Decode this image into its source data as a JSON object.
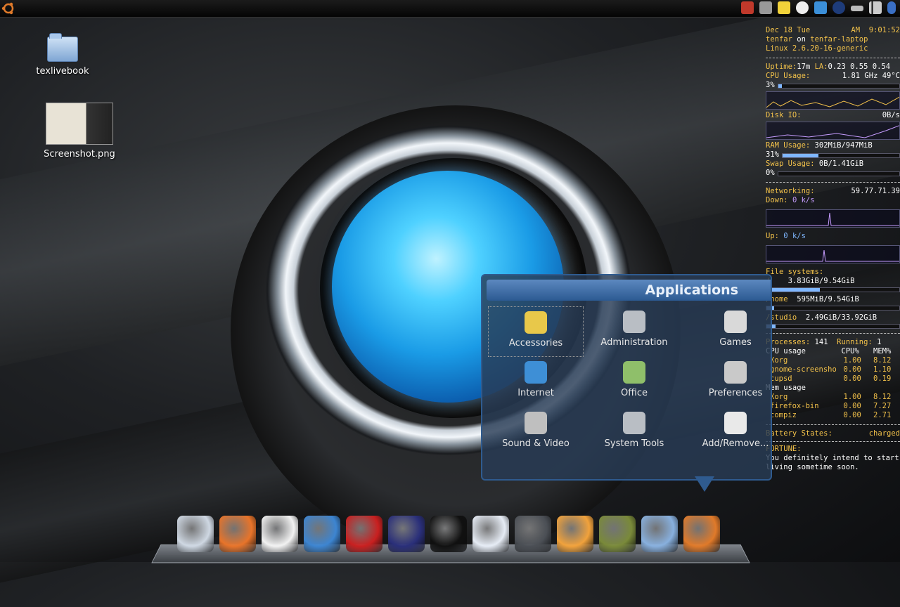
{
  "top_panel": {
    "menu_icon": "ubuntu-logo-icon",
    "tray_icons": [
      "logout-icon",
      "volume-icon",
      "notes-icon",
      "gnome-foot-icon",
      "network-manager-icon",
      "globe-icon",
      "drive-icon",
      "signal-icon",
      "bluetooth-icon"
    ]
  },
  "desktop": {
    "icons": [
      {
        "label": "texlivebook",
        "icon": "folder-icon"
      },
      {
        "label": "Screenshot.png",
        "icon": "image-thumbnail-icon"
      }
    ]
  },
  "conky": {
    "date": "Dec  18  Tue",
    "ampm": "AM",
    "time": "9:01:52",
    "user": "tenfar",
    "on": "on",
    "host": "tenfar-laptop",
    "kernel": "Linux 2.6.20-16-generic",
    "uptime_label": "Uptime:",
    "uptime": "17m",
    "la_label": "LA:",
    "la": "0.23 0.55 0.54",
    "cpu_label": "CPU Usage:",
    "cpu_freq": "1.81 GHz 49°C",
    "cpu_pct": "3%",
    "cpu_fraction": 0.03,
    "disk_label": "Disk IO:",
    "disk_val": "0B/s",
    "ram_label": "RAM Usage:",
    "ram_val": "302MiB/947MiB",
    "ram_pct": "31%",
    "ram_fraction": 0.31,
    "swap_label": "Swap Usage:",
    "swap_val": "0B/1.41GiB",
    "swap_pct": "0%",
    "swap_fraction": 0.0,
    "net_label": "Networking:",
    "net_ip": "59.77.71.39",
    "down_label": "Down:",
    "down_val": "0 k/s",
    "up_label": "Up:",
    "up_val": "0 k/s",
    "fs_label": "File systems:",
    "fs": [
      {
        "mount": "/",
        "val": "3.83GiB/9.54GiB",
        "fraction": 0.4
      },
      {
        "mount": "/home",
        "val": "595MiB/9.54GiB",
        "fraction": 0.06
      },
      {
        "mount": "/studio",
        "val": "2.49GiB/33.92GiB",
        "fraction": 0.07
      }
    ],
    "proc_label": "Processes:",
    "proc_count": "141",
    "running_label": "Running:",
    "running_count": "1",
    "cpu_usage_title": "CPU usage",
    "cpu_col": "CPU%",
    "mem_col": "MEM%",
    "cpu_procs": [
      {
        "name": "Xorg",
        "cpu": "1.00",
        "mem": "8.12"
      },
      {
        "name": "gnome-screensho",
        "cpu": "0.00",
        "mem": "1.10"
      },
      {
        "name": "cupsd",
        "cpu": "0.00",
        "mem": "0.19"
      }
    ],
    "mem_usage_title": "Mem usage",
    "mem_procs": [
      {
        "name": "Xorg",
        "cpu": "1.00",
        "mem": "8.12"
      },
      {
        "name": "firefox-bin",
        "cpu": "0.00",
        "mem": "7.27"
      },
      {
        "name": "compiz",
        "cpu": "0.00",
        "mem": "2.71"
      }
    ],
    "battery_label": "Battery States:",
    "battery_val": "charged",
    "fortune_label": "FORTUNE:",
    "fortune_text": "You definitely intend to start living sometime soon."
  },
  "apps_menu": {
    "title": "Applications",
    "items": [
      {
        "label": "Accessories",
        "icon": "accessories-icon",
        "color": "#e8c84a"
      },
      {
        "label": "Administration",
        "icon": "gear-icon",
        "color": "#b9bec4"
      },
      {
        "label": "Games",
        "icon": "joystick-icon",
        "color": "#d9d9d9"
      },
      {
        "label": "Internet",
        "icon": "globe-icon",
        "color": "#3e8fd6"
      },
      {
        "label": "Office",
        "icon": "office-icon",
        "color": "#8fbf6a"
      },
      {
        "label": "Preferences",
        "icon": "preferences-icon",
        "color": "#c9c9c9"
      },
      {
        "label": "Sound & Video",
        "icon": "film-reel-icon",
        "color": "#bfbfbf"
      },
      {
        "label": "System Tools",
        "icon": "gear-icon",
        "color": "#b9bec4"
      },
      {
        "label": "Add/Remove...",
        "icon": "package-cd-icon",
        "color": "#e9e9e9"
      }
    ]
  },
  "dock": {
    "items": [
      {
        "icon": "computer-icon",
        "color": "#cfd8e3"
      },
      {
        "icon": "firefox-icon",
        "color": "#e8742a"
      },
      {
        "icon": "pidgin-icon",
        "color": "#f2f2f2"
      },
      {
        "icon": "fish-icon",
        "color": "#3d85d1"
      },
      {
        "icon": "dictionary-icon",
        "color": "#c92020"
      },
      {
        "icon": "eclipse-icon",
        "color": "#2a2f7a"
      },
      {
        "icon": "amarok-icon",
        "color": "#111111"
      },
      {
        "icon": "mplayer-icon",
        "color": "#e6ecf5"
      },
      {
        "icon": "terminal-icon",
        "color": "#4b4f55"
      },
      {
        "icon": "picture-viewer-icon",
        "color": "#f1a23c"
      },
      {
        "icon": "books-icon",
        "color": "#7a8a3a"
      },
      {
        "icon": "folder-icon",
        "color": "#88b0de"
      },
      {
        "icon": "ubuntu-logo-icon",
        "color": "#e07a2a"
      }
    ]
  }
}
